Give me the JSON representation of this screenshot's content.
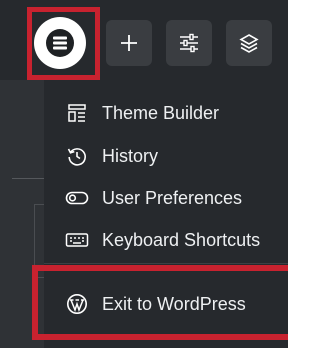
{
  "topbar": {
    "buttons": [
      {
        "icon": "app-menu-icon"
      },
      {
        "icon": "plus-icon"
      },
      {
        "icon": "sliders-icon"
      },
      {
        "icon": "layers-icon"
      }
    ]
  },
  "menu": {
    "items": [
      {
        "label": "Theme Builder",
        "icon": "theme-builder-icon"
      },
      {
        "label": "History",
        "icon": "history-icon"
      },
      {
        "label": "User Preferences",
        "icon": "toggle-icon"
      },
      {
        "label": "Keyboard Shortcuts",
        "icon": "keyboard-icon"
      }
    ],
    "exit": {
      "label": "Exit to WordPress",
      "icon": "wordpress-icon"
    }
  },
  "colors": {
    "background": "#26292d",
    "button": "#3a3d41",
    "text": "#eef0f2",
    "highlight": "#c8222f"
  }
}
